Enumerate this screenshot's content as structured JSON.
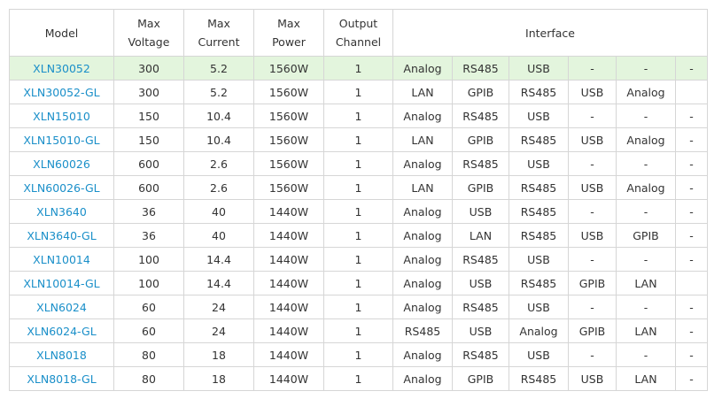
{
  "table": {
    "headers": {
      "model": "Model",
      "max_voltage": [
        "Max",
        "Voltage"
      ],
      "max_current": [
        "Max",
        "Current"
      ],
      "max_power": [
        "Max",
        "Power"
      ],
      "output_channel": [
        "Output",
        "Channel"
      ],
      "interface": "Interface"
    },
    "colors": {
      "link": "#1a8fc9",
      "highlight_row": "#e3f5dd",
      "border": "#d6d6d6",
      "text": "#333333"
    },
    "rows": [
      {
        "model": "XLN30052",
        "voltage": "300",
        "current": "5.2",
        "power": "1560W",
        "channel": "1",
        "interfaces": [
          "Analog",
          "RS485",
          "USB",
          "-",
          "-",
          "-"
        ],
        "highlight": true
      },
      {
        "model": "XLN30052-GL",
        "voltage": "300",
        "current": "5.2",
        "power": "1560W",
        "channel": "1",
        "interfaces": [
          "LAN",
          "GPIB",
          "RS485",
          "USB",
          "Analog",
          ""
        ]
      },
      {
        "model": "XLN15010",
        "voltage": "150",
        "current": "10.4",
        "power": "1560W",
        "channel": "1",
        "interfaces": [
          "Analog",
          "RS485",
          "USB",
          "-",
          "-",
          "-"
        ]
      },
      {
        "model": "XLN15010-GL",
        "voltage": "150",
        "current": "10.4",
        "power": "1560W",
        "channel": "1",
        "interfaces": [
          "LAN",
          "GPIB",
          "RS485",
          "USB",
          "Analog",
          "-"
        ]
      },
      {
        "model": "XLN60026",
        "voltage": "600",
        "current": "2.6",
        "power": "1560W",
        "channel": "1",
        "interfaces": [
          "Analog",
          "RS485",
          "USB",
          "-",
          "-",
          "-"
        ]
      },
      {
        "model": "XLN60026-GL",
        "voltage": "600",
        "current": "2.6",
        "power": "1560W",
        "channel": "1",
        "interfaces": [
          "LAN",
          "GPIB",
          "RS485",
          "USB",
          "Analog",
          "-"
        ]
      },
      {
        "model": "XLN3640",
        "voltage": "36",
        "current": "40",
        "power": "1440W",
        "channel": "1",
        "interfaces": [
          "Analog",
          "USB",
          "RS485",
          "-",
          "-",
          "-"
        ]
      },
      {
        "model": "XLN3640-GL",
        "voltage": "36",
        "current": "40",
        "power": "1440W",
        "channel": "1",
        "interfaces": [
          "Analog",
          "LAN",
          "RS485",
          "USB",
          "GPIB",
          "-"
        ]
      },
      {
        "model": "XLN10014",
        "voltage": "100",
        "current": "14.4",
        "power": "1440W",
        "channel": "1",
        "interfaces": [
          "Analog",
          "RS485",
          "USB",
          "-",
          "-",
          "-"
        ]
      },
      {
        "model": "XLN10014-GL",
        "voltage": "100",
        "current": "14.4",
        "power": "1440W",
        "channel": "1",
        "interfaces": [
          "Analog",
          "USB",
          "RS485",
          "GPIB",
          "LAN",
          ""
        ]
      },
      {
        "model": "XLN6024",
        "voltage": "60",
        "current": "24",
        "power": "1440W",
        "channel": "1",
        "interfaces": [
          "Analog",
          "RS485",
          "USB",
          "-",
          "-",
          "-"
        ]
      },
      {
        "model": "XLN6024-GL",
        "voltage": "60",
        "current": "24",
        "power": "1440W",
        "channel": "1",
        "interfaces": [
          "RS485",
          "USB",
          "Analog",
          "GPIB",
          "LAN",
          "-"
        ]
      },
      {
        "model": "XLN8018",
        "voltage": "80",
        "current": "18",
        "power": "1440W",
        "channel": "1",
        "interfaces": [
          "Analog",
          "RS485",
          "USB",
          "-",
          "-",
          "-"
        ]
      },
      {
        "model": "XLN8018-GL",
        "voltage": "80",
        "current": "18",
        "power": "1440W",
        "channel": "1",
        "interfaces": [
          "Analog",
          "GPIB",
          "RS485",
          "USB",
          "LAN",
          "-"
        ]
      }
    ]
  }
}
